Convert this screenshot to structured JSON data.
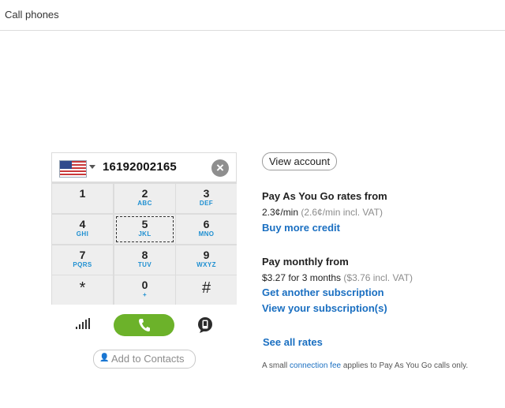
{
  "header": {
    "title": "Call phones"
  },
  "dialer": {
    "country_flag": "us-flag-icon",
    "number": "16192002165",
    "keys": [
      {
        "digit": "1",
        "letters": ""
      },
      {
        "digit": "2",
        "letters": "ABC"
      },
      {
        "digit": "3",
        "letters": "DEF"
      },
      {
        "digit": "4",
        "letters": "GHI"
      },
      {
        "digit": "5",
        "letters": "JKL"
      },
      {
        "digit": "6",
        "letters": "MNO"
      },
      {
        "digit": "7",
        "letters": "PQRS"
      },
      {
        "digit": "8",
        "letters": "TUV"
      },
      {
        "digit": "9",
        "letters": "WXYZ"
      },
      {
        "digit": "*",
        "letters": ""
      },
      {
        "digit": "0",
        "letters": "+"
      },
      {
        "digit": "#",
        "letters": ""
      }
    ],
    "call_color": "#6cb22a",
    "add_contacts_label": "Add to Contacts"
  },
  "account": {
    "view_account_label": "View account",
    "payg_heading": "Pay As You Go rates from",
    "payg_rate": "2.3¢/min",
    "payg_vat": "(2.6¢/min incl. VAT)",
    "buy_credit_label": "Buy more credit",
    "monthly_heading": "Pay monthly from",
    "monthly_rate": "$3.27 for 3 months",
    "monthly_vat": "($3.76 incl. VAT)",
    "get_subscription_label": "Get another subscription",
    "view_subscriptions_label": "View your subscription(s)",
    "see_all_rates_label": "See all rates",
    "fine_print_before": "A small ",
    "fine_print_link": "connection fee",
    "fine_print_after": " applies to Pay As You Go calls only."
  },
  "colors": {
    "link": "#1a6fc1",
    "key_letters": "#1e8fd1"
  }
}
